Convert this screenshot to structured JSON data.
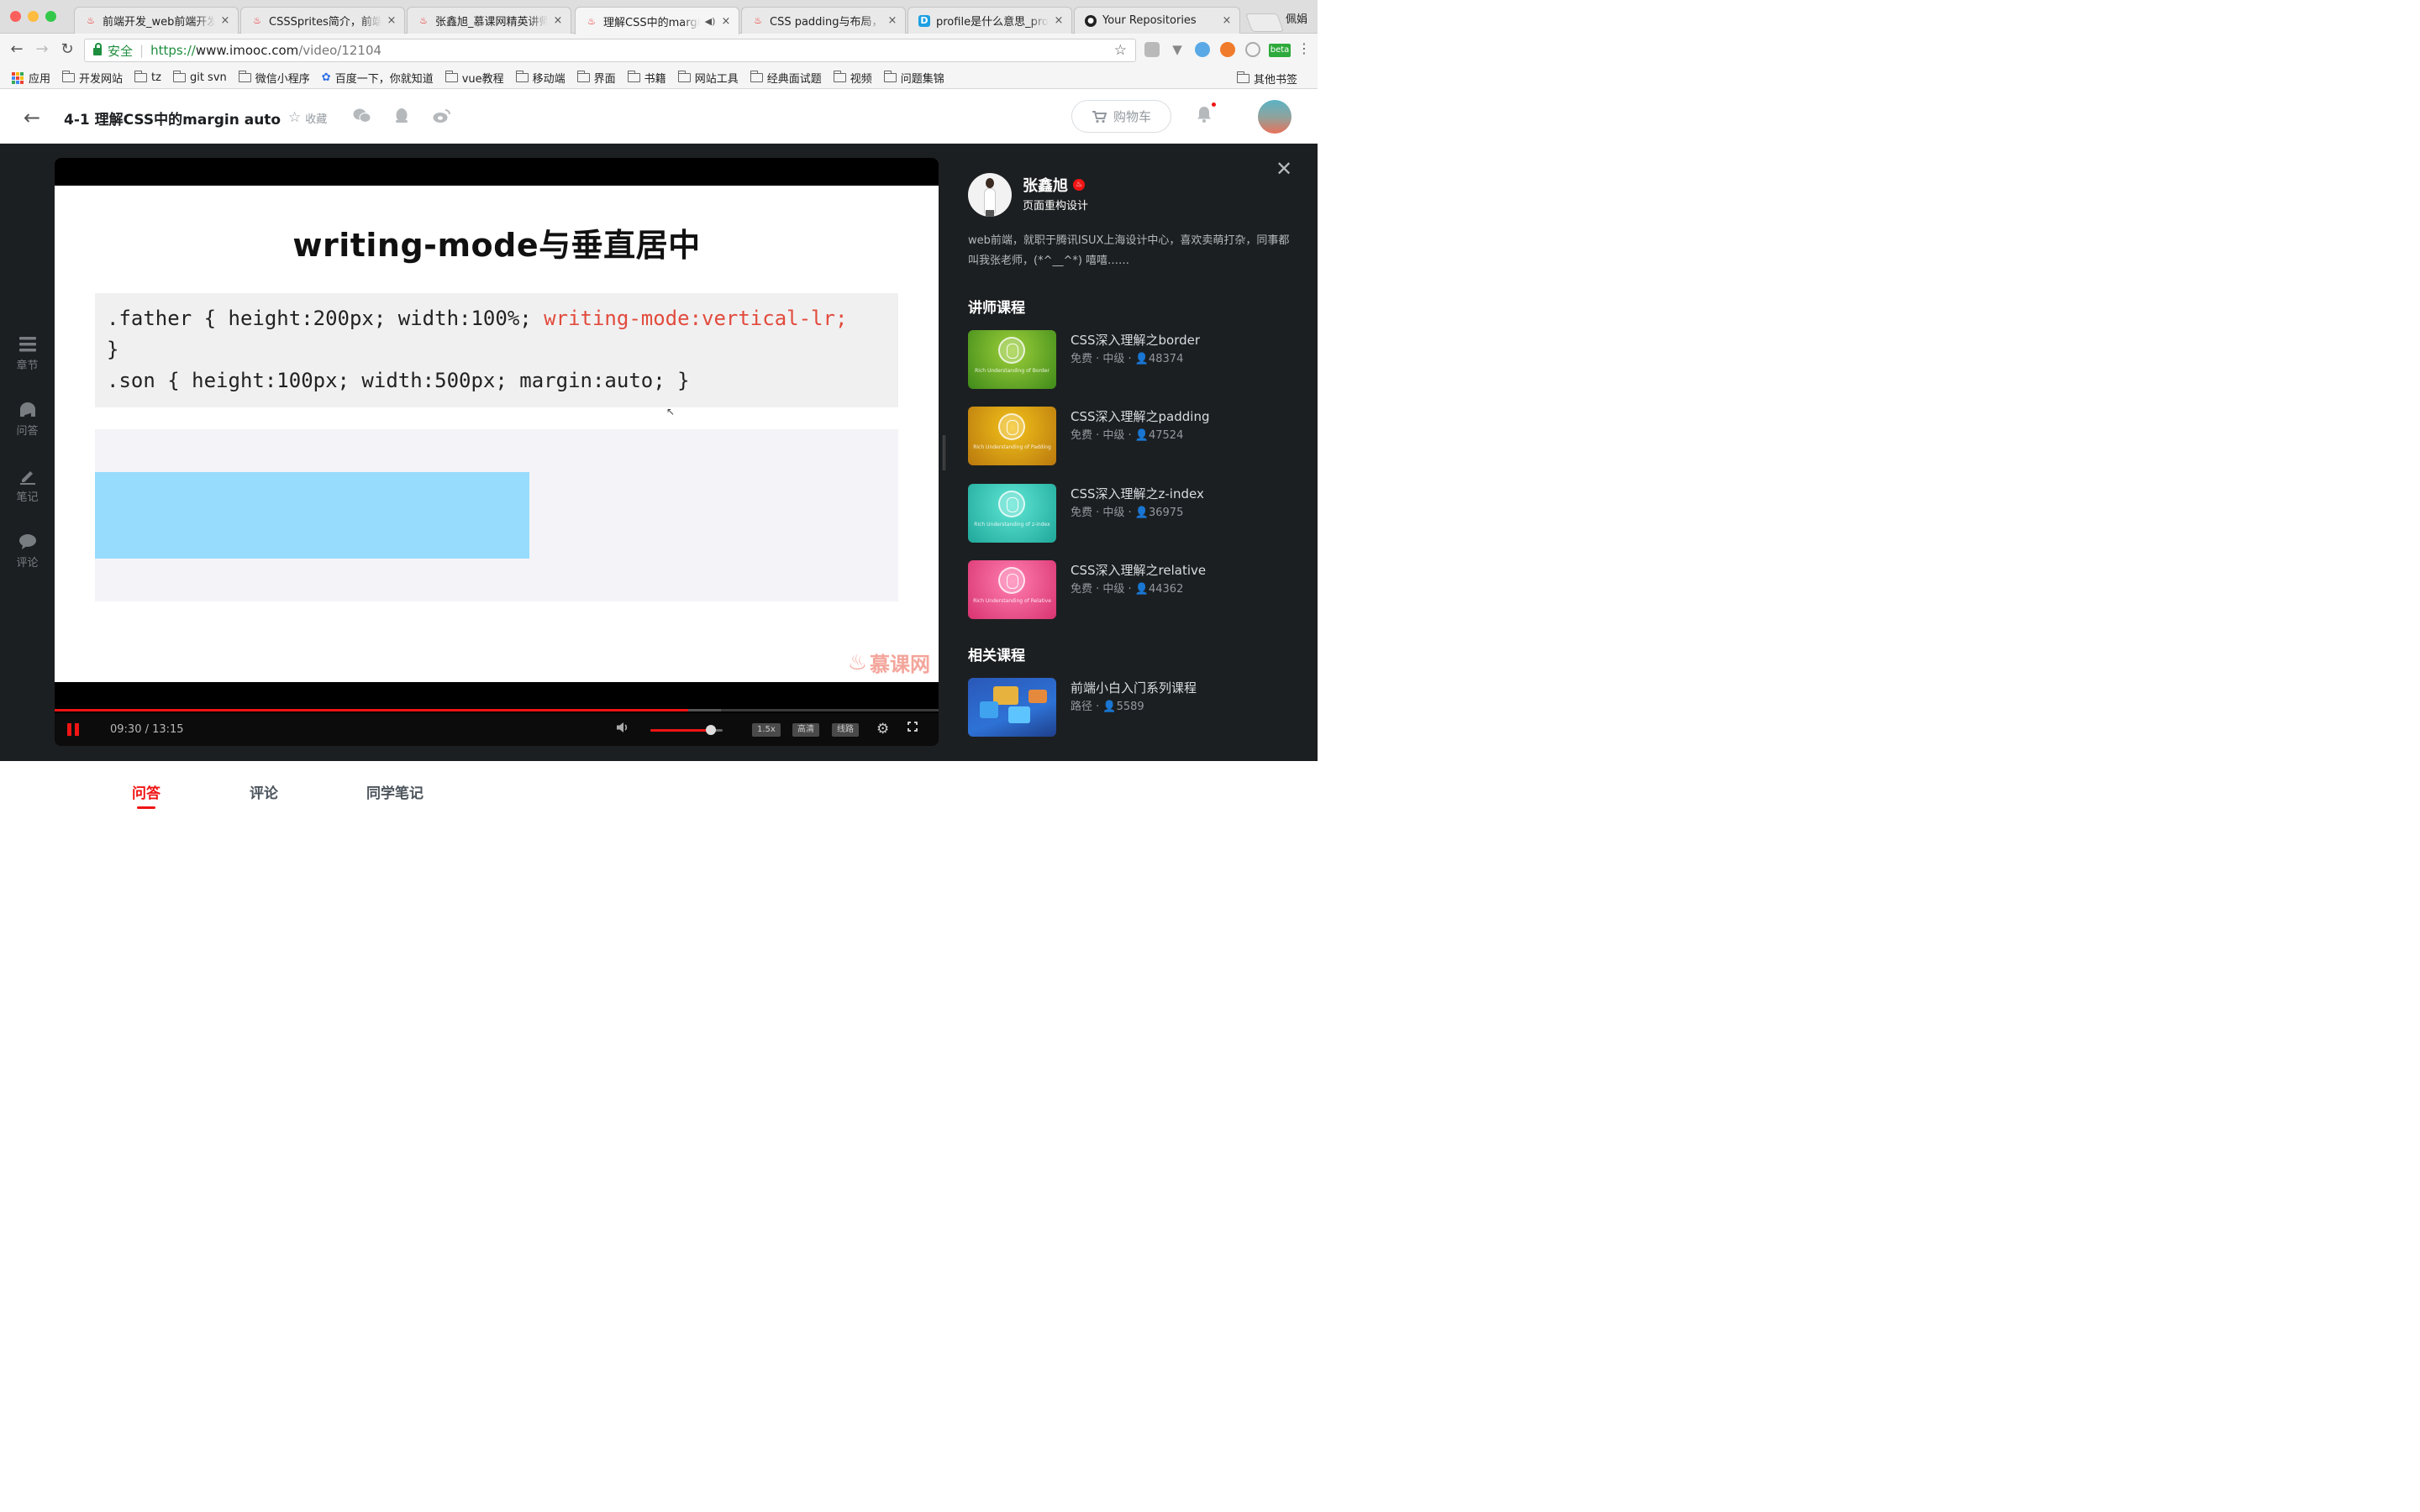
{
  "browser": {
    "tabs": [
      {
        "title": "前端开发_web前端开发",
        "icon": "imooc-flame-icon",
        "active": false
      },
      {
        "title": "CSSSprites简介，前端",
        "icon": "imooc-flame-icon",
        "active": false
      },
      {
        "title": "张鑫旭_慕课网精英讲师",
        "icon": "imooc-flame-icon",
        "active": false
      },
      {
        "title": "理解CSS中的margin",
        "icon": "imooc-flame-icon",
        "active": true,
        "audio": true
      },
      {
        "title": "CSS padding与布局，C",
        "icon": "imooc-flame-icon",
        "active": false
      },
      {
        "title": "profile是什么意思_profi",
        "icon": "dict-icon",
        "active": false
      },
      {
        "title": "Your Repositories",
        "icon": "github-icon",
        "active": false
      }
    ],
    "profile_name": "佩娟",
    "secure_label": "安全",
    "url_scheme": "https://",
    "url_host": "www.imooc.com",
    "url_path": "/video/12104",
    "ext_badge": "beta",
    "bookmarks": [
      {
        "label": "应用",
        "icon": "apps-grid-icon"
      },
      {
        "label": "开发网站",
        "icon": "folder-icon"
      },
      {
        "label": "tz",
        "icon": "folder-icon"
      },
      {
        "label": "git svn",
        "icon": "folder-icon"
      },
      {
        "label": "微信小程序",
        "icon": "folder-icon"
      },
      {
        "label": "百度一下，你就知道",
        "icon": "baidu-paw-icon"
      },
      {
        "label": "vue教程",
        "icon": "folder-icon"
      },
      {
        "label": "移动端",
        "icon": "folder-icon"
      },
      {
        "label": "界面",
        "icon": "folder-icon"
      },
      {
        "label": "书籍",
        "icon": "folder-icon"
      },
      {
        "label": "网站工具",
        "icon": "folder-icon"
      },
      {
        "label": "经典面试题",
        "icon": "folder-icon"
      },
      {
        "label": "视频",
        "icon": "folder-icon"
      },
      {
        "label": "问题集锦",
        "icon": "folder-icon"
      }
    ],
    "other_bookmarks": "其他书签"
  },
  "header": {
    "lesson_title": "4-1 理解CSS中的margin auto",
    "collect_label": "收藏",
    "cart_label": "购物车"
  },
  "left_rail": [
    {
      "label": "章节",
      "icon": "chapter-list-icon"
    },
    {
      "label": "问答",
      "icon": "qa-icon"
    },
    {
      "label": "笔记",
      "icon": "pen-note-icon"
    },
    {
      "label": "评论",
      "icon": "comment-bubble-icon"
    }
  ],
  "slide": {
    "title": "writing-mode与垂直居中",
    "code_line1_plain": ".father { height:200px; width:100%; ",
    "code_line1_red": "writing-mode:vertical-lr;",
    "code_line2": "}",
    "code_line3": ".son { height:100px; width:500px; margin:auto; }",
    "watermark": "慕课网"
  },
  "player": {
    "time_current": "09:30",
    "time_total": "13:15",
    "time_display": "09:30 / 13:15",
    "progress_fraction": 0.717,
    "buffer_fraction": 0.754,
    "volume_fraction": 0.84,
    "speed_label": "1.5x",
    "quality_label": "高清",
    "route_label": "线路"
  },
  "teacher": {
    "name": "张鑫旭",
    "job": "页面重构设计",
    "bio": "web前端，就职于腾讯ISUX上海设计中心，喜欢卖萌打杂，同事都叫我张老师，(*^__^*) 嘻嘻……"
  },
  "teacher_courses_title": "讲师课程",
  "teacher_courses": [
    {
      "title": "CSS深入理解之border",
      "meta": "免费 · 中级 · 👤48374",
      "thumb_caption": "Rich Understanding of Border",
      "color_a": "#9ed03a",
      "color_b": "#3f8a1a"
    },
    {
      "title": "CSS深入理解之padding",
      "meta": "免费 · 中级 · 👤47524",
      "thumb_caption": "Rich Understanding of Padding",
      "color_a": "#f2c21a",
      "color_b": "#b9780e"
    },
    {
      "title": "CSS深入理解之z-index",
      "meta": "免费 · 中级 · 👤36975",
      "thumb_caption": "Rich Understanding of z-index",
      "color_a": "#5fe6d4",
      "color_b": "#1fa79a"
    },
    {
      "title": "CSS深入理解之relative",
      "meta": "免费 · 中级 · 👤44362",
      "thumb_caption": "Rich Understanding of Relative",
      "color_a": "#ff7fb2",
      "color_b": "#d8336f"
    }
  ],
  "related_title": "相关课程",
  "related_courses": [
    {
      "title": "前端小白入门系列课程",
      "meta": "路径 · 👤5589"
    }
  ],
  "bottom_tabs": [
    {
      "label": "问答",
      "active": true
    },
    {
      "label": "评论",
      "active": false
    },
    {
      "label": "同学笔记",
      "active": false
    }
  ]
}
